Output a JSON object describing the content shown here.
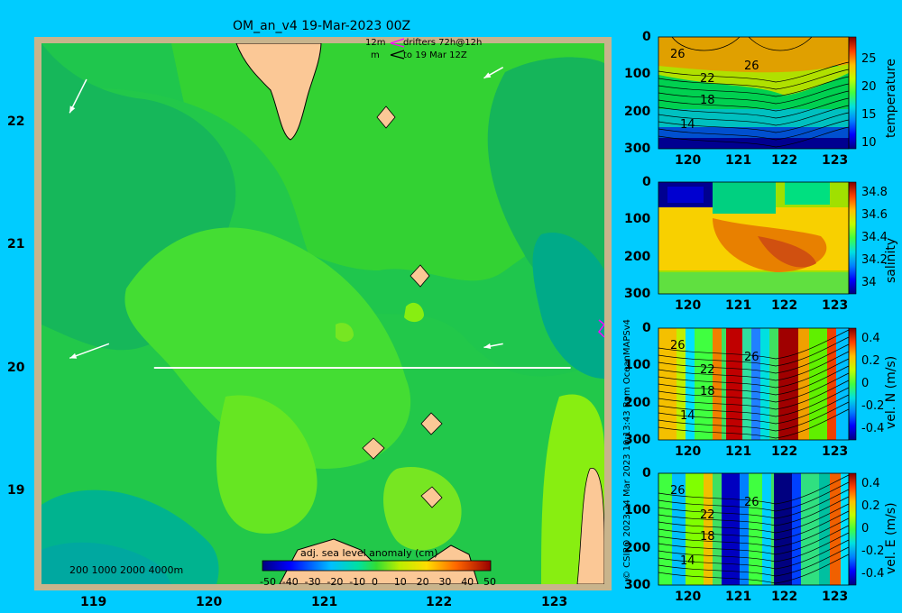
{
  "header": {
    "title": "OM_an_v4  19-Mar-2023 00Z"
  },
  "drifters": {
    "line1_left": "12m",
    "line1_right": "drifters 72h@12h",
    "line2_left": "m",
    "line2_right": "to 19 Mar 12Z"
  },
  "bathymetry_legend": "200  1000  2000  4000m",
  "credit": "© CSIRO 2023   24 Mar 2023 10:13:43 Bpm OceanMAPSv4",
  "colors": {
    "background": "#00ccff",
    "land": "#fbc896",
    "frame": "#c8b48c",
    "section_line": "#ffffff"
  },
  "chart_data": [
    {
      "type": "heatmap",
      "name": "map",
      "title": "OM_an_v4  19-Mar-2023 00Z",
      "x_ticks": [
        "119",
        "120",
        "121",
        "122",
        "123"
      ],
      "y_ticks": [
        "22",
        "21",
        "20",
        "19"
      ],
      "xlim": [
        118.5,
        123.5
      ],
      "ylim": [
        18.2,
        22.7
      ],
      "colorbar": {
        "label": "adj. sea level anomaly (cm)",
        "ticks": [
          "-50",
          "-40",
          "-30",
          "-20",
          "-10",
          "0",
          "10",
          "20",
          "30",
          "40",
          "50"
        ],
        "range": [
          -50,
          50
        ]
      },
      "section": {
        "lon": [
          119.5,
          123.2
        ],
        "lat": [
          20.0,
          20.0
        ]
      },
      "arrows": [
        {
          "lon": 118.9,
          "lat": 22.4,
          "dlon": -0.15,
          "dlat": -0.28
        },
        {
          "lon": 122.6,
          "lat": 22.5,
          "dlon": -0.17,
          "dlat": -0.09
        },
        {
          "lon": 119.1,
          "lat": 20.2,
          "dlon": -0.35,
          "dlat": -0.12
        },
        {
          "lon": 122.6,
          "lat": 20.2,
          "dlon": -0.17,
          "dlat": -0.03
        }
      ]
    },
    {
      "type": "heatmap",
      "name": "temperature",
      "x_ticks": [
        "120",
        "121",
        "122",
        "123"
      ],
      "y_ticks": [
        "0",
        "100",
        "200",
        "300"
      ],
      "colorbar": {
        "label": "temperature",
        "ticks": [
          "25",
          "20",
          "15",
          "10"
        ],
        "range": [
          9,
          29
        ]
      },
      "contour_labels": [
        "26",
        "26",
        "22",
        "18",
        "14"
      ]
    },
    {
      "type": "heatmap",
      "name": "salinity",
      "x_ticks": [
        "120",
        "121",
        "122",
        "123"
      ],
      "y_ticks": [
        "0",
        "100",
        "200",
        "300"
      ],
      "colorbar": {
        "label": "salinity",
        "ticks": [
          "34.8",
          "34.6",
          "34.4",
          "34.2",
          "34"
        ],
        "range": [
          33.9,
          34.9
        ]
      }
    },
    {
      "type": "heatmap",
      "name": "vel_N",
      "x_ticks": [
        "120",
        "121",
        "122",
        "123"
      ],
      "y_ticks": [
        "0",
        "100",
        "200",
        "300"
      ],
      "colorbar": {
        "label": "vel. N (m/s)",
        "ticks": [
          "0.4",
          "0.2",
          "0",
          "-0.2",
          "-0.4"
        ],
        "range": [
          -0.5,
          0.5
        ]
      },
      "contour_labels": [
        "26",
        "26",
        "22",
        "18",
        "14"
      ]
    },
    {
      "type": "heatmap",
      "name": "vel_E",
      "x_ticks": [
        "120",
        "121",
        "122",
        "123"
      ],
      "y_ticks": [
        "0",
        "100",
        "200",
        "300"
      ],
      "colorbar": {
        "label": "vel. E (m/s)",
        "ticks": [
          "0.4",
          "0.2",
          "0",
          "-0.2",
          "-0.4"
        ],
        "range": [
          -0.5,
          0.5
        ]
      },
      "contour_labels": [
        "26",
        "26",
        "22",
        "18",
        "14"
      ]
    }
  ]
}
